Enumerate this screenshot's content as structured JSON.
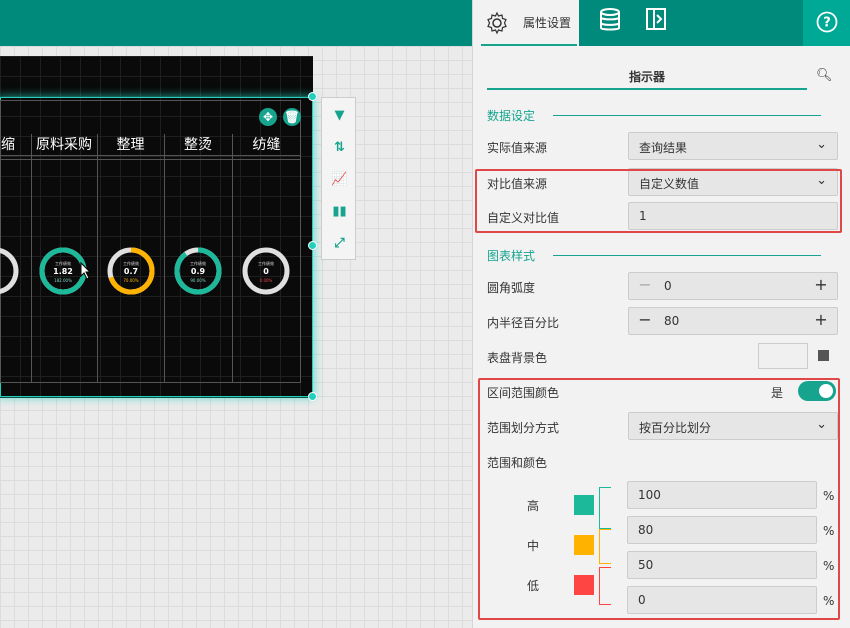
{
  "canvas": {
    "table_headers": [
      "缩",
      "原料采购",
      "整理",
      "整烫",
      "纺缝"
    ],
    "gauges": [
      {
        "label": "工作绩效",
        "value": "1.82",
        "pct": "182.00%",
        "color": "#1cb99a",
        "fraction": 1.0,
        "pct_color": "#7fd3c4"
      },
      {
        "label": "工作绩效",
        "value": "0.7",
        "pct": "70.00%",
        "color": "#ffb300",
        "fraction": 0.7,
        "pct_color": "#ffb300"
      },
      {
        "label": "工作绩效",
        "value": "0.9",
        "pct": "90.00%",
        "color": "#1cb99a",
        "fraction": 0.9,
        "pct_color": "#7fd3c4"
      },
      {
        "label": "工作绩效",
        "value": "0",
        "pct": "0.00%",
        "color": "#e0e0e0",
        "fraction": 0.0,
        "pct_color": "#e04848"
      }
    ],
    "side_tools": [
      "filter-icon",
      "sort-icon",
      "chart-settings-icon",
      "bar-chart-icon",
      "resize-icon"
    ]
  },
  "panel": {
    "tab_properties": "属性设置",
    "search_label": "指示器",
    "section_data": "数据设定",
    "actual_source_label": "实际值来源",
    "actual_source_value": "查询结果",
    "compare_source_label": "对比值来源",
    "compare_source_value": "自定义数值",
    "custom_compare_label": "自定义对比值",
    "custom_compare_value": "1",
    "section_style": "图表样式",
    "corner_label": "圆角弧度",
    "corner_value": "0",
    "inner_radius_label": "内半径百分比",
    "inner_radius_value": "80",
    "dial_bg_label": "表盘背景色",
    "range_color_label": "区间范围颜色",
    "range_color_toggle": "是",
    "range_split_label": "范围划分方式",
    "range_split_value": "按百分比划分",
    "range_and_color_label": "范围和颜色",
    "ranges": [
      {
        "label": "高",
        "color": "#1cb99a"
      },
      {
        "label": "中",
        "color": "#ffb300"
      },
      {
        "label": "低",
        "color": "#ff4444"
      }
    ],
    "range_values": [
      "100",
      "80",
      "50",
      "0"
    ],
    "pct_unit": "%"
  }
}
